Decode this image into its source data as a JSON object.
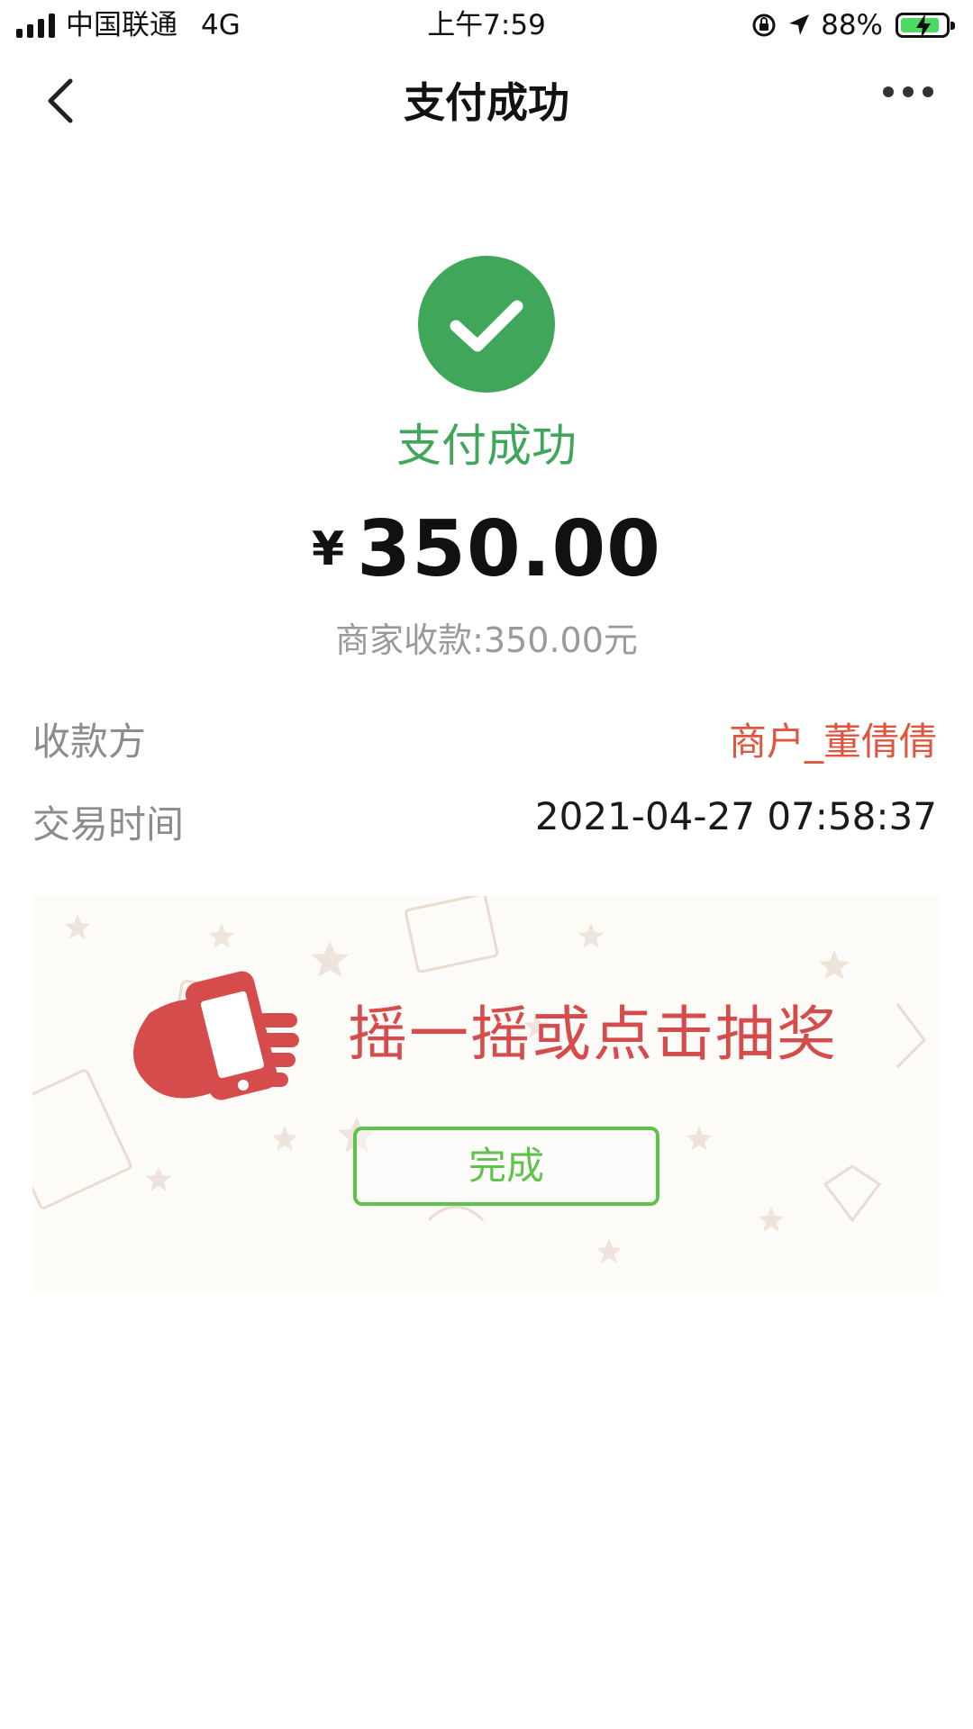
{
  "status_bar": {
    "carrier": "中国联通",
    "network": "4G",
    "time": "上午7:59",
    "battery": "88%",
    "icons": [
      "signal-icon",
      "rotation-lock-icon",
      "location-icon",
      "battery-charging-icon"
    ],
    "battery_color": "#4cd964"
  },
  "nav": {
    "title": "支付成功",
    "icons": [
      "back-icon",
      "more-icon"
    ]
  },
  "result": {
    "status": "支付成功",
    "currency": "¥",
    "amount": "350.00",
    "merchant_received": "商家收款:350.00元",
    "accent_color": "#3fa65a"
  },
  "details": {
    "payee_label": "收款方",
    "payee_value": "商户_董倩倩",
    "time_label": "交易时间",
    "time_value": "2021-04-27 07:58:37"
  },
  "lottery": {
    "text": "摇一摇或点击抽奖",
    "done_button": "完成",
    "text_color": "#d64c4c",
    "button_color": "#5fc24a"
  }
}
